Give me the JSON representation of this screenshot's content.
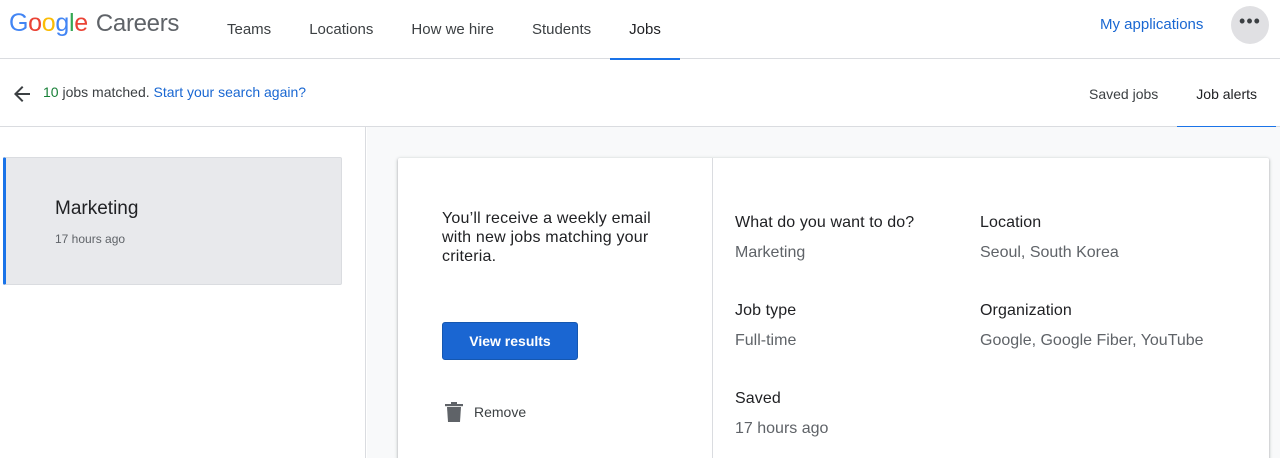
{
  "header": {
    "logo_google": [
      "G",
      "o",
      "o",
      "g",
      "l",
      "e"
    ],
    "logo_colors": [
      "#4285F4",
      "#EA4335",
      "#FBBC05",
      "#4285F4",
      "#34A853",
      "#EA4335"
    ],
    "logo_careers": "Careers",
    "nav": [
      {
        "label": "Teams"
      },
      {
        "label": "Locations"
      },
      {
        "label": "How we hire"
      },
      {
        "label": "Students"
      },
      {
        "label": "Jobs"
      }
    ],
    "my_applications": "My applications",
    "more_icon": "more-horiz-icon"
  },
  "subbar": {
    "count": "10",
    "matched_text": " jobs matched. ",
    "search_again": "Start your search again?",
    "tabs": [
      {
        "label": "Saved jobs"
      },
      {
        "label": "Job alerts"
      }
    ]
  },
  "alerts": [
    {
      "title": "Marketing",
      "time": "17 hours ago"
    }
  ],
  "detail": {
    "email_text": "You’ll receive a weekly email with new jobs matching your criteria.",
    "view_results": "View results",
    "remove": "Remove",
    "fields": {
      "what": {
        "label": "What do you want to do?",
        "value": "Marketing"
      },
      "location": {
        "label": "Location",
        "value": "Seoul, South Korea"
      },
      "job_type": {
        "label": "Job type",
        "value": "Full-time"
      },
      "organization": {
        "label": "Organization",
        "value": "Google, Google Fiber, YouTube"
      },
      "saved": {
        "label": "Saved",
        "value": "17 hours ago"
      }
    }
  },
  "colors": {
    "accent": "#1a73e8",
    "button": "#1a66d2",
    "count": "#188038"
  }
}
